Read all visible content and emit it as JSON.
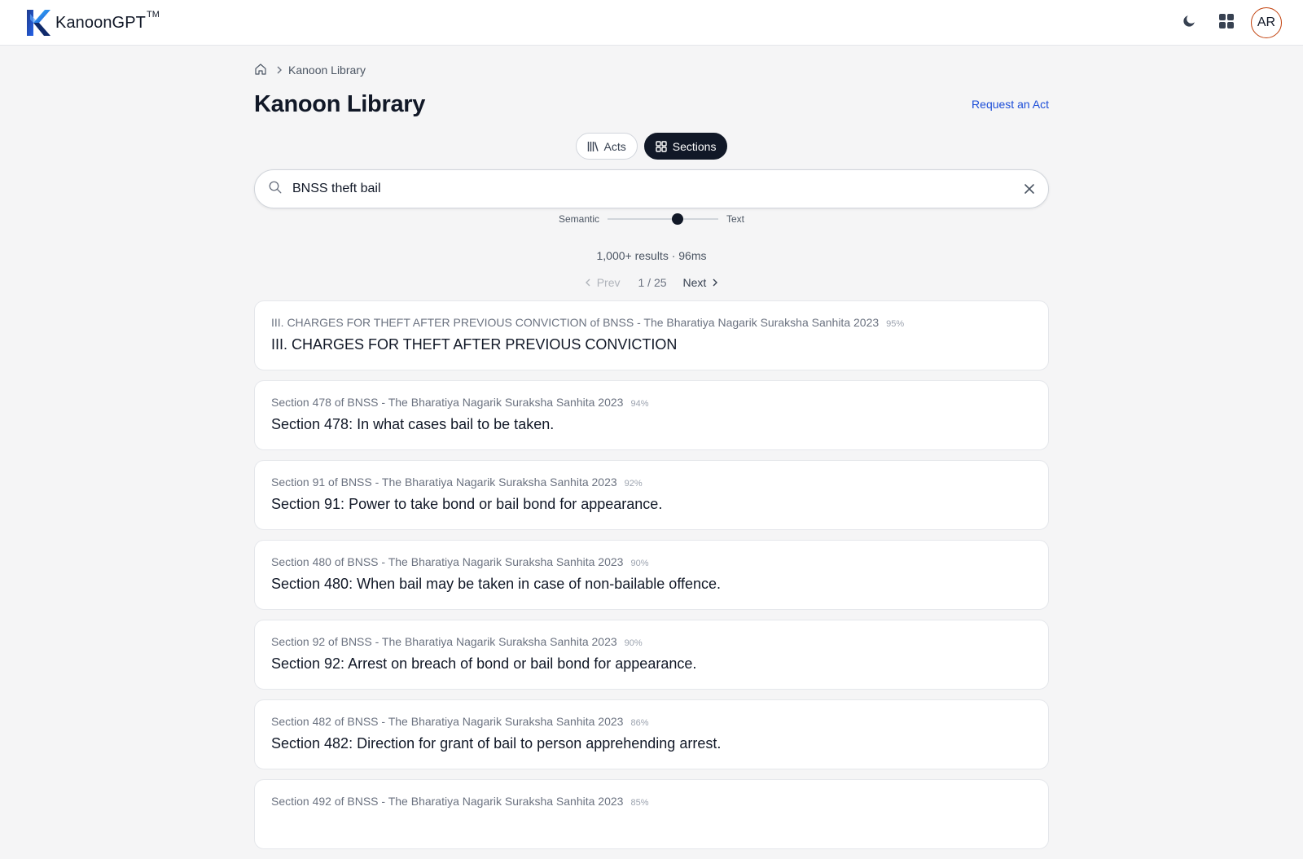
{
  "app": {
    "name": "KanoonGPT",
    "tm": "TM",
    "avatar_initials": "AR"
  },
  "icons": {
    "logo": "kanoon-k-logo",
    "theme": "moon-icon",
    "apps": "grid-icon",
    "home": "home-icon",
    "search": "search-icon",
    "clear": "close-icon"
  },
  "colors": {
    "accent_link": "#1d4ed8",
    "active_tab": "#111827",
    "avatar_ring": "#c2410c"
  },
  "breadcrumb": {
    "current": "Kanoon Library"
  },
  "page": {
    "title": "Kanoon Library",
    "request_link": "Request an Act"
  },
  "tabs": {
    "acts": "Acts",
    "sections": "Sections",
    "active": "sections"
  },
  "search": {
    "value": "BNSS theft bail"
  },
  "mode_slider": {
    "left_label": "Semantic",
    "right_label": "Text",
    "position_fraction": 0.63
  },
  "results_meta": {
    "summary": "1,000+ results · 96ms"
  },
  "pagination": {
    "prev": "Prev",
    "position": "1 / 25",
    "next": "Next"
  },
  "results": [
    {
      "meta": "III. CHARGES FOR THEFT AFTER PREVIOUS CONVICTION of BNSS - The Bharatiya Nagarik Suraksha Sanhita 2023",
      "score": "95%",
      "title": "III. CHARGES FOR THEFT AFTER PREVIOUS CONVICTION"
    },
    {
      "meta": "Section 478 of BNSS - The Bharatiya Nagarik Suraksha Sanhita 2023",
      "score": "94%",
      "title": "Section 478: In what cases bail to be taken."
    },
    {
      "meta": "Section 91 of BNSS - The Bharatiya Nagarik Suraksha Sanhita 2023",
      "score": "92%",
      "title": "Section 91: Power to take bond or bail bond for appearance."
    },
    {
      "meta": "Section 480 of BNSS - The Bharatiya Nagarik Suraksha Sanhita 2023",
      "score": "90%",
      "title": "Section 480: When bail may be taken in case of non-bailable offence."
    },
    {
      "meta": "Section 92 of BNSS - The Bharatiya Nagarik Suraksha Sanhita 2023",
      "score": "90%",
      "title": "Section 92: Arrest on breach of bond or bail bond for appearance."
    },
    {
      "meta": "Section 482 of BNSS - The Bharatiya Nagarik Suraksha Sanhita 2023",
      "score": "86%",
      "title": "Section 482: Direction for grant of bail to person apprehending arrest."
    },
    {
      "meta": "Section 492 of BNSS - The Bharatiya Nagarik Suraksha Sanhita 2023",
      "score": "85%",
      "title": ""
    }
  ]
}
